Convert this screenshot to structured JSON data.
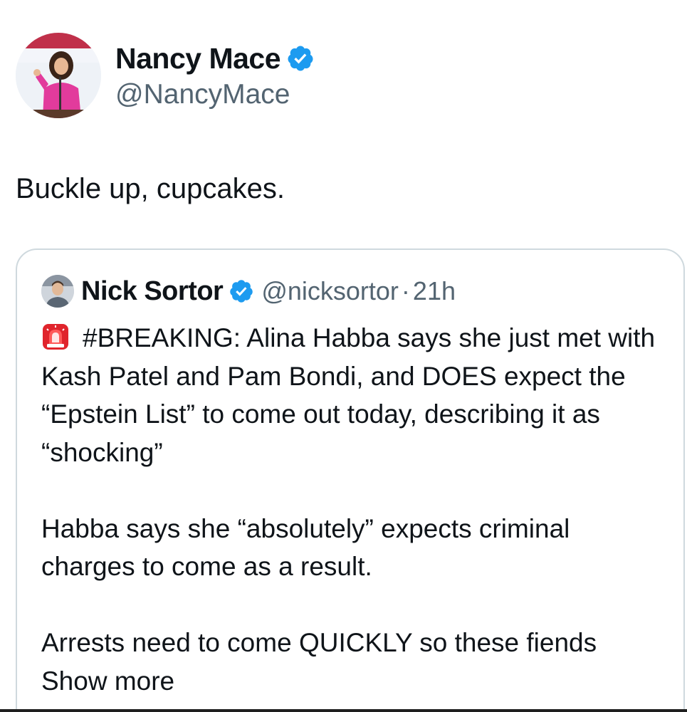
{
  "author": {
    "name": "Nancy Mace",
    "handle": "@NancyMace",
    "verified": true,
    "avatar": "profile-photo-pink-speaker"
  },
  "tweet": {
    "text": "Buckle up, cupcakes."
  },
  "quoted_tweet": {
    "name": "Nick Sortor",
    "handle": "@nicksortor",
    "separator": "·",
    "time": "21h",
    "verified": true,
    "siren_icon": "police-siren-emoji",
    "paragraph_1": "#BREAKING: Alina Habba says she just met with Kash Patel and Pam Bondi, and DOES expect the “Epstein List” to come out today, describing it as “shocking”",
    "paragraph_2": "Habba says she “absolutely” expects criminal charges to come as a result.",
    "paragraph_3_text": "Arrests need to come QUICKLY so these fiends",
    "show_more": "Show more"
  },
  "colors": {
    "verified_blue": "#1d9bf0",
    "secondary_text": "#536471",
    "border": "#cfd9de"
  }
}
